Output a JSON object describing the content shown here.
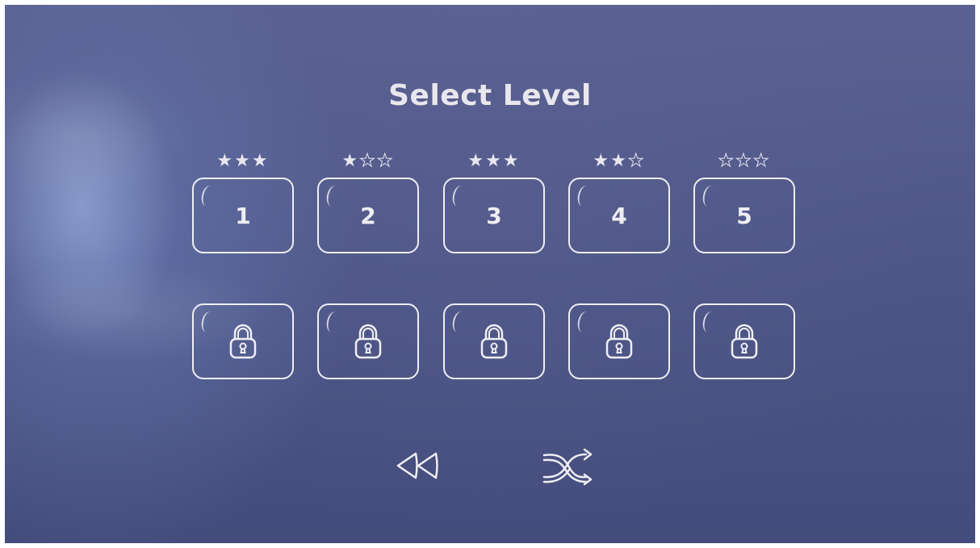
{
  "title": "Select Level",
  "levels": [
    {
      "label": "1",
      "stars": 3,
      "locked": false
    },
    {
      "label": "2",
      "stars": 1,
      "locked": false
    },
    {
      "label": "3",
      "stars": 3,
      "locked": false
    },
    {
      "label": "4",
      "stars": 2,
      "locked": false
    },
    {
      "label": "5",
      "stars": 0,
      "locked": false
    },
    {
      "label": "",
      "stars": 0,
      "locked": true
    },
    {
      "label": "",
      "stars": 0,
      "locked": true
    },
    {
      "label": "",
      "stars": 0,
      "locked": true
    },
    {
      "label": "",
      "stars": 0,
      "locked": true
    },
    {
      "label": "",
      "stars": 0,
      "locked": true
    }
  ],
  "max_stars": 3,
  "controls": {
    "back_icon": "rewind-icon",
    "shuffle_icon": "shuffle-icon"
  },
  "colors": {
    "background": "#4f5788",
    "chalk": "#eeeef3"
  }
}
